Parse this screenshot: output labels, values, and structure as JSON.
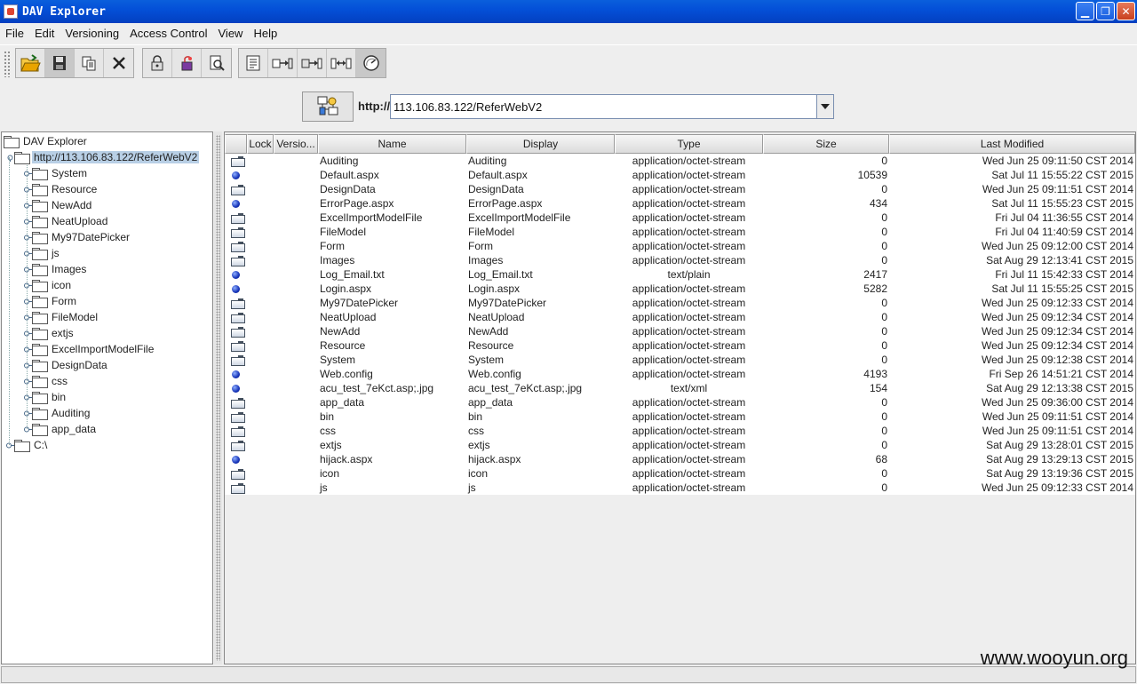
{
  "window": {
    "title": "DAV Explorer"
  },
  "menu": [
    "File",
    "Edit",
    "Versioning",
    "Access Control",
    "View",
    "Help"
  ],
  "toolbar": {
    "group1": [
      "open-folder-icon",
      "save-icon",
      "copy-icon",
      "delete-icon"
    ],
    "group2": [
      "lock-icon",
      "unlock-icon",
      "view-icon"
    ],
    "group3": [
      "properties-icon",
      "version-checkout-icon",
      "version-checkin-icon",
      "version-compare-icon",
      "refresh-icon"
    ]
  },
  "url": {
    "prefix": "http://",
    "value": "113.106.83.122/ReferWebV2"
  },
  "tree": {
    "root": "DAV Explorer",
    "host": "http://113.106.83.122/ReferWebV2",
    "children": [
      "System",
      "Resource",
      "NewAdd",
      "NeatUpload",
      "My97DatePicker",
      "js",
      "Images",
      "icon",
      "Form",
      "FileModel",
      "extjs",
      "ExcelImportModelFile",
      "DesignData",
      "css",
      "bin",
      "Auditing",
      "app_data"
    ],
    "drive": "C:\\"
  },
  "table": {
    "columns": [
      "",
      "Lock",
      "Versio...",
      "Name",
      "Display",
      "Type",
      "Size",
      "Last Modified"
    ],
    "rows": [
      {
        "kind": "folder",
        "name": "Auditing",
        "display": "Auditing",
        "type": "application/octet-stream",
        "size": "0",
        "modified": "Wed Jun 25 09:11:50 CST 2014"
      },
      {
        "kind": "file",
        "name": "Default.aspx",
        "display": "Default.aspx",
        "type": "application/octet-stream",
        "size": "10539",
        "modified": "Sat Jul 11 15:55:22 CST 2015"
      },
      {
        "kind": "folder",
        "name": "DesignData",
        "display": "DesignData",
        "type": "application/octet-stream",
        "size": "0",
        "modified": "Wed Jun 25 09:11:51 CST 2014"
      },
      {
        "kind": "file",
        "name": "ErrorPage.aspx",
        "display": "ErrorPage.aspx",
        "type": "application/octet-stream",
        "size": "434",
        "modified": "Sat Jul 11 15:55:23 CST 2015"
      },
      {
        "kind": "folder",
        "name": "ExcelImportModelFile",
        "display": "ExcelImportModelFile",
        "type": "application/octet-stream",
        "size": "0",
        "modified": "Fri Jul 04 11:36:55 CST 2014"
      },
      {
        "kind": "folder",
        "name": "FileModel",
        "display": "FileModel",
        "type": "application/octet-stream",
        "size": "0",
        "modified": "Fri Jul 04 11:40:59 CST 2014"
      },
      {
        "kind": "folder",
        "name": "Form",
        "display": "Form",
        "type": "application/octet-stream",
        "size": "0",
        "modified": "Wed Jun 25 09:12:00 CST 2014"
      },
      {
        "kind": "folder",
        "name": "Images",
        "display": "Images",
        "type": "application/octet-stream",
        "size": "0",
        "modified": "Sat Aug 29 12:13:41 CST 2015"
      },
      {
        "kind": "file",
        "name": "Log_Email.txt",
        "display": "Log_Email.txt",
        "type": "text/plain",
        "size": "2417",
        "modified": "Fri Jul 11 15:42:33 CST 2014"
      },
      {
        "kind": "file",
        "name": "Login.aspx",
        "display": "Login.aspx",
        "type": "application/octet-stream",
        "size": "5282",
        "modified": "Sat Jul 11 15:55:25 CST 2015"
      },
      {
        "kind": "folder",
        "name": "My97DatePicker",
        "display": "My97DatePicker",
        "type": "application/octet-stream",
        "size": "0",
        "modified": "Wed Jun 25 09:12:33 CST 2014"
      },
      {
        "kind": "folder",
        "name": "NeatUpload",
        "display": "NeatUpload",
        "type": "application/octet-stream",
        "size": "0",
        "modified": "Wed Jun 25 09:12:34 CST 2014"
      },
      {
        "kind": "folder",
        "name": "NewAdd",
        "display": "NewAdd",
        "type": "application/octet-stream",
        "size": "0",
        "modified": "Wed Jun 25 09:12:34 CST 2014"
      },
      {
        "kind": "folder",
        "name": "Resource",
        "display": "Resource",
        "type": "application/octet-stream",
        "size": "0",
        "modified": "Wed Jun 25 09:12:34 CST 2014"
      },
      {
        "kind": "folder",
        "name": "System",
        "display": "System",
        "type": "application/octet-stream",
        "size": "0",
        "modified": "Wed Jun 25 09:12:38 CST 2014"
      },
      {
        "kind": "file",
        "name": "Web.config",
        "display": "Web.config",
        "type": "application/octet-stream",
        "size": "4193",
        "modified": "Fri Sep 26 14:51:21 CST 2014"
      },
      {
        "kind": "file",
        "name": "acu_test_7eKct.asp;.jpg",
        "display": "acu_test_7eKct.asp;.jpg",
        "type": "text/xml",
        "size": "154",
        "modified": "Sat Aug 29 12:13:38 CST 2015"
      },
      {
        "kind": "folder",
        "name": "app_data",
        "display": "app_data",
        "type": "application/octet-stream",
        "size": "0",
        "modified": "Wed Jun 25 09:36:00 CST 2014"
      },
      {
        "kind": "folder",
        "name": "bin",
        "display": "bin",
        "type": "application/octet-stream",
        "size": "0",
        "modified": "Wed Jun 25 09:11:51 CST 2014"
      },
      {
        "kind": "folder",
        "name": "css",
        "display": "css",
        "type": "application/octet-stream",
        "size": "0",
        "modified": "Wed Jun 25 09:11:51 CST 2014"
      },
      {
        "kind": "folder",
        "name": "extjs",
        "display": "extjs",
        "type": "application/octet-stream",
        "size": "0",
        "modified": "Sat Aug 29 13:28:01 CST 2015"
      },
      {
        "kind": "file",
        "name": "hijack.aspx",
        "display": "hijack.aspx",
        "type": "application/octet-stream",
        "size": "68",
        "modified": "Sat Aug 29 13:29:13 CST 2015"
      },
      {
        "kind": "folder",
        "name": "icon",
        "display": "icon",
        "type": "application/octet-stream",
        "size": "0",
        "modified": "Sat Aug 29 13:19:36 CST 2015"
      },
      {
        "kind": "folder",
        "name": "js",
        "display": "js",
        "type": "application/octet-stream",
        "size": "0",
        "modified": "Wed Jun 25 09:12:33 CST 2014"
      }
    ]
  },
  "watermark": "www.wooyun.org",
  "colors": {
    "titlebar": "#0450d8",
    "selection": "#b8cfe5",
    "file_dot": "#1633b8"
  }
}
